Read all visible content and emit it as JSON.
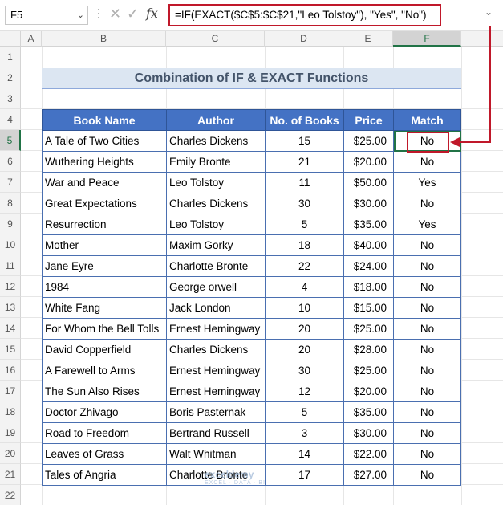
{
  "formula_bar": {
    "name_box": "F5",
    "formula": "=IF(EXACT($C$5:$C$21,\"Leo Tolstoy\"), \"Yes\", \"No\")",
    "fx_label": "fx",
    "cancel_glyph": "✕",
    "enter_glyph": "✓"
  },
  "columns": [
    "A",
    "B",
    "C",
    "D",
    "E",
    "F"
  ],
  "selected_column": "F",
  "rows": [
    "1",
    "2",
    "3",
    "4",
    "5",
    "6",
    "7",
    "8",
    "9",
    "10",
    "11",
    "12",
    "13",
    "14",
    "15",
    "16",
    "17",
    "18",
    "19",
    "20",
    "21",
    "22"
  ],
  "selected_row": "5",
  "title": "Combination of IF & EXACT Functions",
  "table": {
    "headers": [
      "Book Name",
      "Author",
      "No. of Books",
      "Price",
      "Match"
    ],
    "rows": [
      [
        "A Tale of Two Cities",
        "Charles Dickens",
        "15",
        "$25.00",
        "No"
      ],
      [
        "Wuthering Heights",
        "Emily Bronte",
        "21",
        "$20.00",
        "No"
      ],
      [
        "War and Peace",
        "Leo Tolstoy",
        "11",
        "$50.00",
        "Yes"
      ],
      [
        "Great Expectations",
        "Charles Dickens",
        "30",
        "$30.00",
        "No"
      ],
      [
        "Resurrection",
        "Leo Tolstoy",
        "5",
        "$35.00",
        "Yes"
      ],
      [
        "Mother",
        "Maxim Gorky",
        "18",
        "$40.00",
        "No"
      ],
      [
        "Jane Eyre",
        "Charlotte Bronte",
        "22",
        "$24.00",
        "No"
      ],
      [
        "1984",
        "George orwell",
        "4",
        "$18.00",
        "No"
      ],
      [
        "White Fang",
        "Jack London",
        "10",
        "$15.00",
        "No"
      ],
      [
        "For Whom the Bell Tolls",
        "Ernest Hemingway",
        "20",
        "$25.00",
        "No"
      ],
      [
        "David Copperfield",
        "Charles Dickens",
        "20",
        "$28.00",
        "No"
      ],
      [
        "A Farewell to Arms",
        "Ernest Hemingway",
        "30",
        "$25.00",
        "No"
      ],
      [
        "The Sun Also Rises",
        "Ernest Hemingway",
        "12",
        "$20.00",
        "No"
      ],
      [
        "Doctor Zhivago",
        "Boris Pasternak",
        "5",
        "$35.00",
        "No"
      ],
      [
        "Road to Freedom",
        "Bertrand Russell",
        "3",
        "$30.00",
        "No"
      ],
      [
        "Leaves of Grass",
        "Walt Whitman",
        "14",
        "$22.00",
        "No"
      ],
      [
        "Tales of Angria",
        "Charlotte Bronte",
        "17",
        "$27.00",
        "No"
      ]
    ]
  },
  "watermark": {
    "name": "exceldemy",
    "tagline": "EXCEL · DATA · BI"
  },
  "colors": {
    "header_fill": "#4472c4",
    "title_fill": "#dce6f2",
    "highlight": "#c0182a",
    "excel_green": "#217346"
  }
}
